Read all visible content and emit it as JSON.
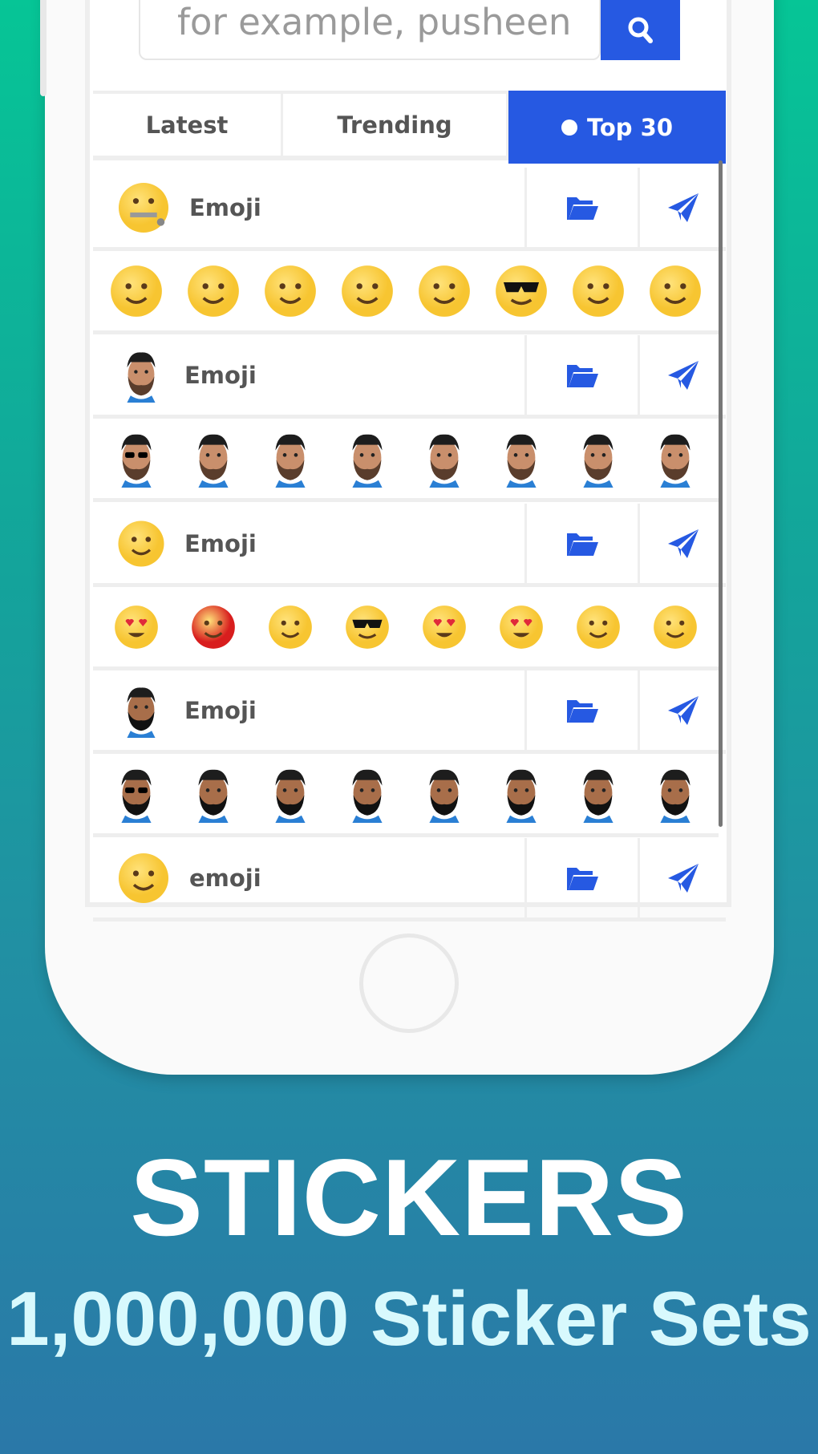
{
  "search": {
    "placeholder": "for example, pusheen",
    "button_icon": "search-icon"
  },
  "tabs": [
    {
      "label": "Latest",
      "active": false
    },
    {
      "label": "Trending",
      "active": false
    },
    {
      "label": "Top 30",
      "active": true
    }
  ],
  "accent": "#2659e2",
  "sticker_sets": [
    {
      "name": "Emoji",
      "cover": "zipper-mouth-face",
      "stickers": [
        "winking-face",
        "winking-tongue-face",
        "thinking-face",
        "rolling-laughing-face",
        "tears-of-joy-face",
        "sunglasses-face",
        "relieved-face",
        "thermometer-face"
      ]
    },
    {
      "name": "Emoji",
      "cover": "bearded-man",
      "stickers": [
        "bearded-man-sunglasses",
        "bearded-man-laughing",
        "bearded-man-surprised",
        "bearded-man-shouting",
        "bearded-man-neutral",
        "bearded-man-winking",
        "bearded-man-sweating",
        "bearded-man-smiling"
      ]
    },
    {
      "name": "Emoji",
      "cover": "smiling-face",
      "stickers": [
        "heart-eyes-face",
        "angry-red-face",
        "unamused-face",
        "mustache-sunglasses-face",
        "heart-eyes-hug-face",
        "heart-eyes-tongue-face",
        "confused-face",
        "smirking-face"
      ]
    },
    {
      "name": "Emoji",
      "cover": "dark-bearded-man",
      "stickers": [
        "dark-man-sunglasses",
        "dark-man-winking",
        "dark-man-neutral",
        "dark-man-shouting",
        "dark-man-smirking",
        "dark-man-exploding",
        "dark-man-smiling",
        "dark-man-halo"
      ]
    },
    {
      "name": "emoji",
      "cover": "smiling-face-leaf",
      "stickers": []
    }
  ],
  "actions": {
    "folder_icon": "folder-open-icon",
    "send_icon": "paper-plane-icon"
  },
  "headline": "STICKERS",
  "subheadline": "1,000,000 Sticker Sets"
}
